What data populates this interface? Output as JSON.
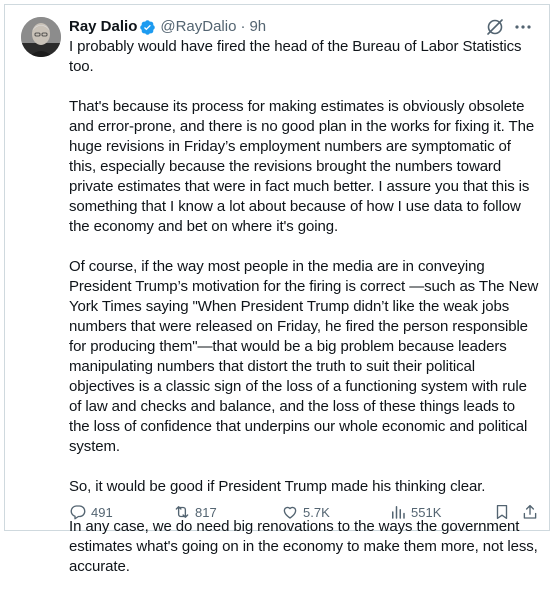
{
  "author": {
    "name": "Ray Dalio",
    "handle": "@RayDalio",
    "separator": "·",
    "time": "9h",
    "verified_color": "#1d9bf0"
  },
  "icons": {
    "verified": "verified-badge-icon",
    "grok": "grok-icon",
    "more": "more-options-icon",
    "reply": "reply-icon",
    "repost": "repost-icon",
    "like": "like-icon",
    "views": "views-icon",
    "bookmark": "bookmark-icon",
    "share": "share-icon"
  },
  "tweet": {
    "paragraphs": [
      "I probably would have fired the head of the Bureau of Labor Statistics too.",
      "That's because its process for making estimates is obviously obsolete and error-prone, and there is no good plan in the works for fixing it. The huge revisions in Friday’s employment numbers are symptomatic of this, especially because the revisions brought the numbers toward private estimates that were in fact much better. I assure you that this is something that I know a lot about because of how I use data to follow the economy and bet on where it's going.",
      "Of course, if the way most people in the media are in conveying President Trump’s motivation for the firing is correct —such as The New York Times saying \"When President Trump didn’t like the weak jobs numbers that were released on Friday, he fired the person responsible for producing them\"—that would be a big problem because leaders manipulating numbers that distort the truth to suit their political objectives is a classic sign of the loss of a functioning system with rule of law and checks and balance, and the loss of these things leads to the loss of confidence that underpins our whole economic and political system.",
      "So, it would be good if President Trump made his thinking clear.",
      "In any case, we do need big renovations to the ways the government estimates what's going on in the economy to make them more, not less, accurate."
    ]
  },
  "metrics": {
    "replies": "491",
    "reposts": "817",
    "likes": "5.7K",
    "views": "551K"
  }
}
